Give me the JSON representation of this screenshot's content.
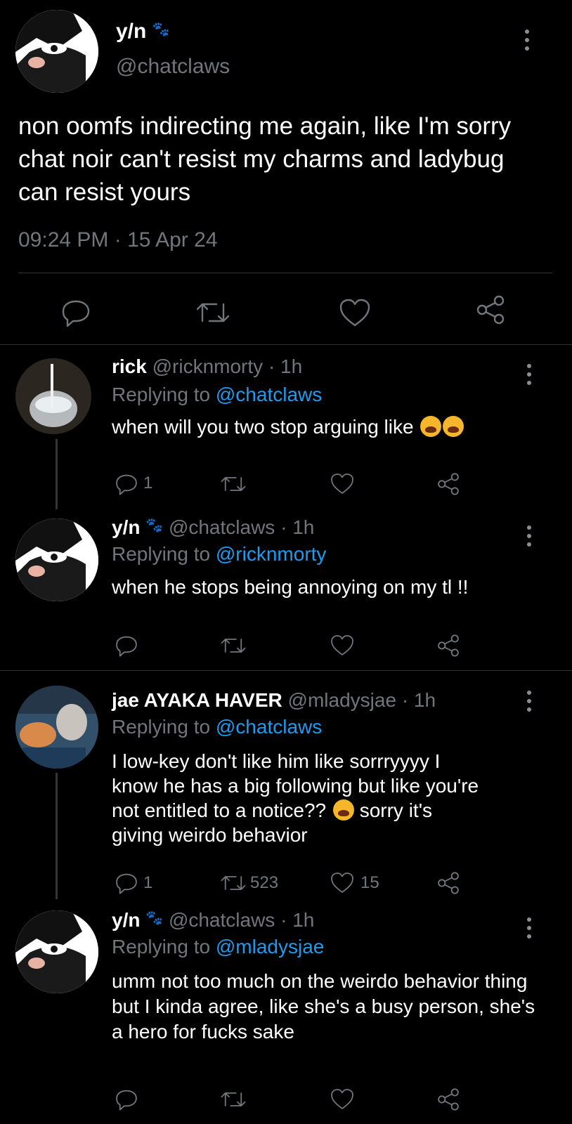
{
  "main_tweet": {
    "name": "y/n",
    "handle": "@chatclaws",
    "text": "non oomfs indirecting me again, like I'm sorry chat noir can't resist my charms and ladybug can resist yours",
    "timestamp": "09:24 PM · 15 Apr 24"
  },
  "replies": [
    {
      "name": "rick",
      "handle": "@ricknmorty",
      "time": "· 1h",
      "replying_label": "Replying to",
      "replying_to": "@chatclaws",
      "text": "when will you two stop arguing like",
      "reply_count": "1",
      "retweet_count": "",
      "like_count": ""
    },
    {
      "name": "y/n",
      "handle": "@chatclaws",
      "time": "· 1h",
      "replying_label": "Replying to",
      "replying_to": "@ricknmorty",
      "text": "when he stops being annoying on my tl !!",
      "reply_count": "",
      "retweet_count": "",
      "like_count": ""
    },
    {
      "name": "jae AYAKA HAVER",
      "handle": "@mladysjae",
      "time": "· 1h",
      "replying_label": "Replying to",
      "replying_to": "@chatclaws",
      "text_1": "I low-key don't like him like sorrryyyy I",
      "text_2": "know he has a big following but like you're",
      "text_3a": "not entitled to a notice??",
      "text_3b": "sorry it's",
      "text_4": "giving weirdo behavior",
      "reply_count": "1",
      "retweet_count": "523",
      "like_count": "15"
    },
    {
      "name": "y/n",
      "handle": "@chatclaws",
      "time": "· 1h",
      "replying_label": "Replying to",
      "replying_to": "@mladysjae",
      "text": "umm not too much on the weirdo behavior thing but I kinda agree, like she's a busy person, she's a hero for fucks sake",
      "reply_count": "",
      "retweet_count": "",
      "like_count": ""
    }
  ],
  "icons": [
    "reply-icon",
    "retweet-icon",
    "like-icon",
    "share-icon",
    "more-icon",
    "paw-icon",
    "crying-emoji"
  ],
  "colors": {
    "background": "#000000",
    "text": "#e7e9ea",
    "muted": "#71767b",
    "link": "#1d9bf0",
    "paw": "#e0245e"
  }
}
